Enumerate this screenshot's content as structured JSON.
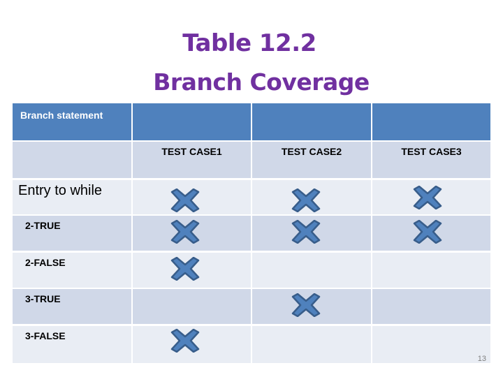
{
  "slide": {
    "title_line1": "Table 12.2",
    "title_line2": "Branch Coverage",
    "page_number": "13"
  },
  "colors": {
    "title": "#7030a0",
    "header": "#4f81bd",
    "row_dark": "#d0d8e8",
    "row_light": "#e9edf4",
    "mark_fill": "#4f81bd",
    "mark_stroke": "#385d8a"
  },
  "table": {
    "header_label": "Branch statement",
    "test_cases": [
      "TEST CASE1",
      "TEST CASE2",
      "TEST CASE3"
    ],
    "rows": [
      {
        "label": "Entry to while",
        "covered": [
          true,
          true,
          true
        ]
      },
      {
        "label": "2-TRUE",
        "covered": [
          true,
          true,
          true
        ]
      },
      {
        "label": "2-FALSE",
        "covered": [
          true,
          false,
          false
        ]
      },
      {
        "label": "3-TRUE",
        "covered": [
          false,
          true,
          false
        ]
      },
      {
        "label": "3-FALSE",
        "covered": [
          true,
          false,
          false
        ]
      }
    ],
    "mark_icon": "cross-mark-icon"
  }
}
